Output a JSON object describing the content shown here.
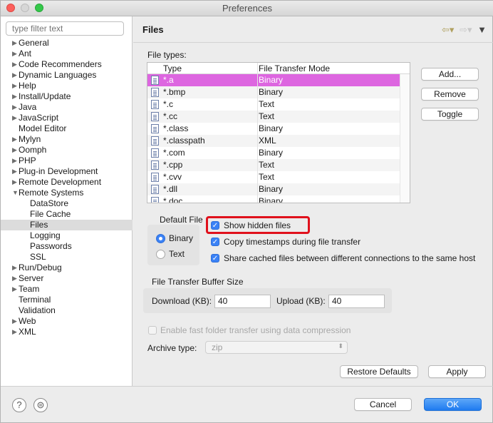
{
  "window": {
    "title": "Preferences"
  },
  "sidebar": {
    "filter_placeholder": "type filter text",
    "items": [
      {
        "label": "General",
        "arrow": "▶",
        "indent": 0
      },
      {
        "label": "Ant",
        "arrow": "▶",
        "indent": 0
      },
      {
        "label": "Code Recommenders",
        "arrow": "▶",
        "indent": 0
      },
      {
        "label": "Dynamic Languages",
        "arrow": "▶",
        "indent": 0
      },
      {
        "label": "Help",
        "arrow": "▶",
        "indent": 0
      },
      {
        "label": "Install/Update",
        "arrow": "▶",
        "indent": 0
      },
      {
        "label": "Java",
        "arrow": "▶",
        "indent": 0
      },
      {
        "label": "JavaScript",
        "arrow": "▶",
        "indent": 0
      },
      {
        "label": "Model Editor",
        "arrow": "",
        "indent": 0
      },
      {
        "label": "Mylyn",
        "arrow": "▶",
        "indent": 0
      },
      {
        "label": "Oomph",
        "arrow": "▶",
        "indent": 0
      },
      {
        "label": "PHP",
        "arrow": "▶",
        "indent": 0
      },
      {
        "label": "Plug-in Development",
        "arrow": "▶",
        "indent": 0
      },
      {
        "label": "Remote Development",
        "arrow": "▶",
        "indent": 0
      },
      {
        "label": "Remote Systems",
        "arrow": "▼",
        "indent": 0
      },
      {
        "label": "DataStore",
        "arrow": "",
        "indent": 1
      },
      {
        "label": "File Cache",
        "arrow": "",
        "indent": 1
      },
      {
        "label": "Files",
        "arrow": "",
        "indent": 1,
        "selected": true
      },
      {
        "label": "Logging",
        "arrow": "",
        "indent": 1
      },
      {
        "label": "Passwords",
        "arrow": "",
        "indent": 1
      },
      {
        "label": "SSL",
        "arrow": "",
        "indent": 1
      },
      {
        "label": "Run/Debug",
        "arrow": "▶",
        "indent": 0
      },
      {
        "label": "Server",
        "arrow": "▶",
        "indent": 0
      },
      {
        "label": "Team",
        "arrow": "▶",
        "indent": 0
      },
      {
        "label": "Terminal",
        "arrow": "",
        "indent": 0
      },
      {
        "label": "Validation",
        "arrow": "",
        "indent": 0
      },
      {
        "label": "Web",
        "arrow": "▶",
        "indent": 0
      },
      {
        "label": "XML",
        "arrow": "▶",
        "indent": 0
      }
    ]
  },
  "main": {
    "title": "Files",
    "file_types_label": "File types:",
    "table": {
      "columns": [
        "Type",
        "File Transfer Mode"
      ],
      "rows": [
        {
          "type": "*.a",
          "mode": "Binary",
          "selected": true
        },
        {
          "type": "*.bmp",
          "mode": "Binary"
        },
        {
          "type": "*.c",
          "mode": "Text"
        },
        {
          "type": "*.cc",
          "mode": "Text"
        },
        {
          "type": "*.class",
          "mode": "Binary"
        },
        {
          "type": "*.classpath",
          "mode": "XML"
        },
        {
          "type": "*.com",
          "mode": "Binary"
        },
        {
          "type": "*.cpp",
          "mode": "Text"
        },
        {
          "type": "*.cvv",
          "mode": "Text"
        },
        {
          "type": "*.dll",
          "mode": "Binary"
        },
        {
          "type": "*.doc",
          "mode": "Binary"
        }
      ]
    },
    "buttons": {
      "add": "Add...",
      "remove": "Remove",
      "toggle": "Toggle"
    },
    "default_file": {
      "label": "Default File",
      "options": [
        "Binary",
        "Text"
      ],
      "selected": "Binary"
    },
    "checkboxes": {
      "show_hidden": {
        "label": "Show hidden files",
        "checked": true
      },
      "copy_timestamps": {
        "label": "Copy timestamps during file transfer",
        "checked": true
      },
      "share_cached": {
        "label": "Share cached files between different connections to the same host",
        "checked": true
      }
    },
    "buffer": {
      "label": "File Transfer Buffer Size",
      "download_label": "Download (KB):",
      "download_value": "40",
      "upload_label": "Upload (KB):",
      "upload_value": "40"
    },
    "fast_transfer": {
      "label": "Enable fast folder transfer using data compression",
      "checked": false
    },
    "archive": {
      "label": "Archive type:",
      "value": "zip"
    },
    "restore_defaults": "Restore Defaults",
    "apply": "Apply"
  },
  "footer": {
    "cancel": "Cancel",
    "ok": "OK"
  },
  "colors": {
    "selection": "#dd66e0",
    "accent": "#3b82f6",
    "highlight": "#e0111c"
  }
}
